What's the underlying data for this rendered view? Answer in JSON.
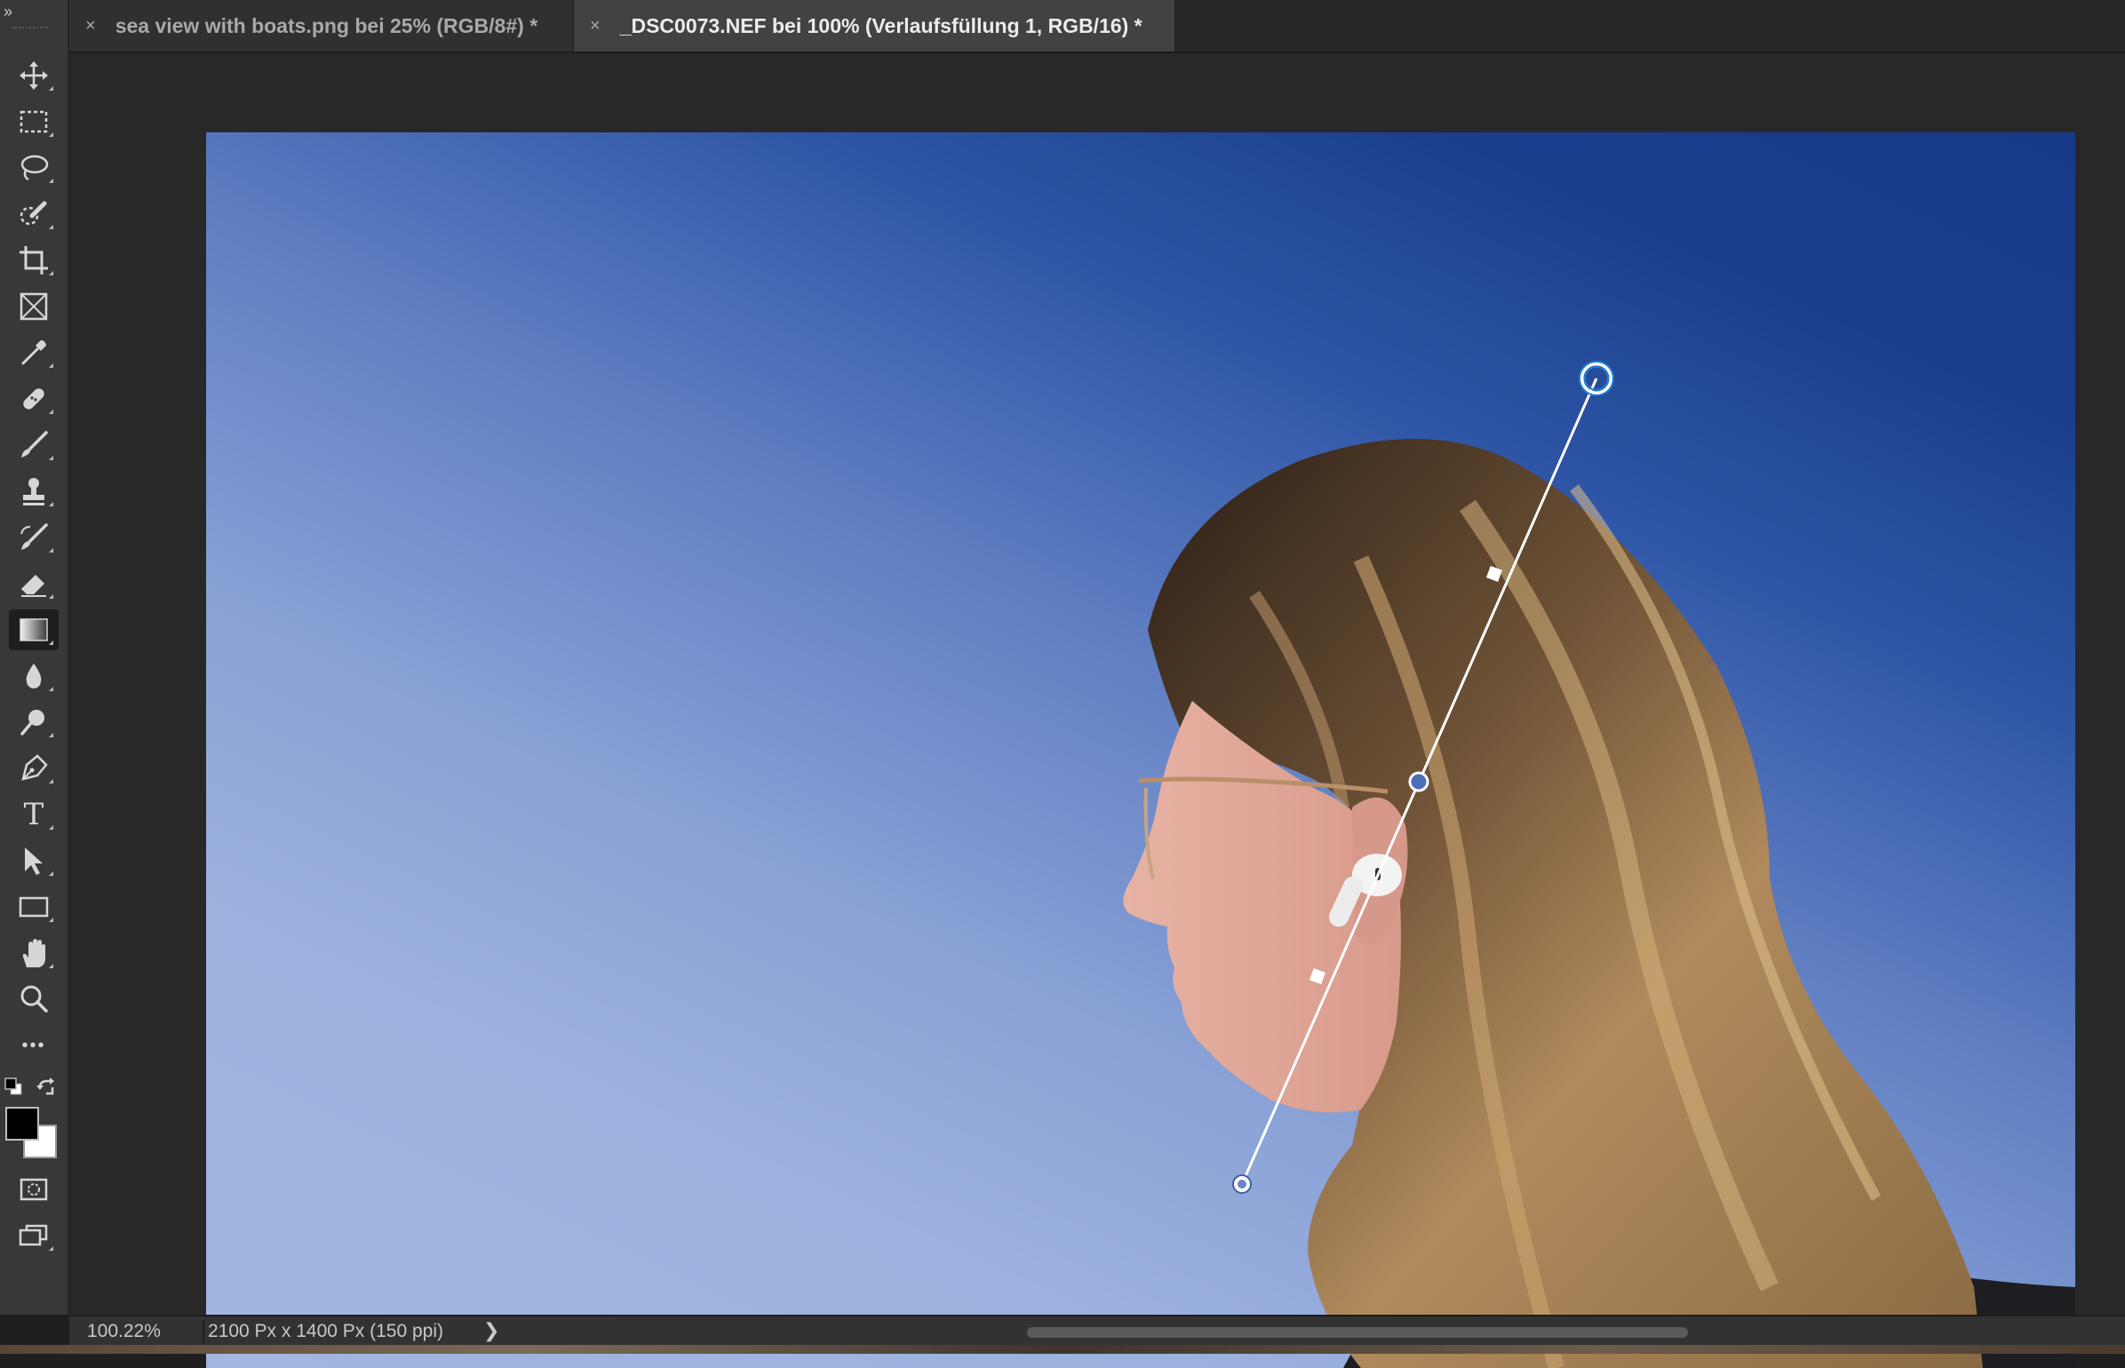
{
  "tabs": [
    {
      "label": "sea view with boats.png bei 25% (RGB/8#) *",
      "active": false,
      "close_icon": "×"
    },
    {
      "label": "_DSC0073.NEF bei 100% (Verlaufsfüllung 1, RGB/16) *",
      "active": true,
      "close_icon": "×"
    }
  ],
  "toolbar": {
    "collapse_glyph": "»",
    "tools": [
      {
        "name": "move-tool",
        "icon": "move-icon"
      },
      {
        "name": "rectangular-marquee-tool",
        "icon": "marquee-icon"
      },
      {
        "name": "lasso-tool",
        "icon": "lasso-icon"
      },
      {
        "name": "quick-selection-tool",
        "icon": "quick-selection-icon"
      },
      {
        "name": "crop-tool",
        "icon": "crop-icon"
      },
      {
        "name": "frame-tool",
        "icon": "frame-icon"
      },
      {
        "name": "eyedropper-tool",
        "icon": "eyedropper-icon"
      },
      {
        "name": "healing-brush-tool",
        "icon": "bandage-icon"
      },
      {
        "name": "brush-tool",
        "icon": "brush-icon"
      },
      {
        "name": "clone-stamp-tool",
        "icon": "stamp-icon"
      },
      {
        "name": "history-brush-tool",
        "icon": "history-brush-icon"
      },
      {
        "name": "eraser-tool",
        "icon": "eraser-icon"
      },
      {
        "name": "gradient-tool",
        "icon": "gradient-icon",
        "active": true
      },
      {
        "name": "blur-tool",
        "icon": "drop-icon"
      },
      {
        "name": "dodge-tool",
        "icon": "dodge-icon"
      },
      {
        "name": "pen-tool",
        "icon": "pen-icon"
      },
      {
        "name": "type-tool",
        "icon": "type-icon",
        "glyph": "T"
      },
      {
        "name": "path-selection-tool",
        "icon": "arrow-icon"
      },
      {
        "name": "rectangle-tool",
        "icon": "rectangle-icon"
      },
      {
        "name": "hand-tool",
        "icon": "hand-icon"
      },
      {
        "name": "zoom-tool",
        "icon": "zoom-icon"
      },
      {
        "name": "more-tools",
        "icon": "ellipsis-icon",
        "glyph": "•••"
      }
    ],
    "foreground_color": "#000000",
    "background_color": "#ffffff"
  },
  "colors": {
    "accent_blue": "#1e7fd4",
    "gradient_dark": "#163a88",
    "gradient_light": "#a2b6e0"
  },
  "status": {
    "zoom": "100.22%",
    "document_info": "2100 Px x 1400 Px (150 ppi)",
    "expand_glyph": "❯"
  }
}
